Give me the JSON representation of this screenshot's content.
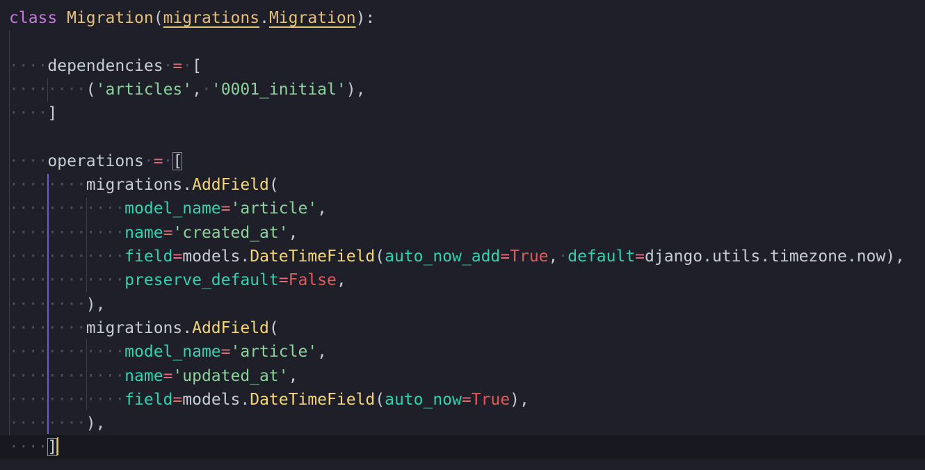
{
  "editor": {
    "language": "python",
    "colors": {
      "background": "#1e1f29",
      "keyword": "#c678dd",
      "class_name": "#e5c07b",
      "function": "#f7d774",
      "string": "#8bd39a",
      "parameter": "#31d2b0",
      "constant": "#e05b5b",
      "operator": "#e06c75",
      "text": "#c9ccd4",
      "indent_guide_active": "#6b5bd6",
      "caret": "#f0c33c"
    },
    "lines": [
      {
        "t": [
          {
            "c": "kw",
            "v": "class"
          },
          {
            "c": "plain",
            "v": " "
          },
          {
            "c": "cls",
            "v": "Migration"
          },
          {
            "c": "plain",
            "v": "("
          },
          {
            "c": "cls ul",
            "v": "migrations"
          },
          {
            "c": "plain",
            "v": "."
          },
          {
            "c": "cls ul",
            "v": "Migration"
          },
          {
            "c": "plain",
            "v": "):"
          }
        ]
      },
      {
        "t": []
      },
      {
        "t": [
          {
            "c": "ws",
            "v": "····"
          },
          {
            "c": "plain",
            "v": "dependencies"
          },
          {
            "c": "ws",
            "v": "·"
          },
          {
            "c": "op",
            "v": "="
          },
          {
            "c": "ws",
            "v": "·"
          },
          {
            "c": "plain",
            "v": "["
          }
        ]
      },
      {
        "t": [
          {
            "c": "ws",
            "v": "········"
          },
          {
            "c": "plain",
            "v": "("
          },
          {
            "c": "str",
            "v": "'articles'"
          },
          {
            "c": "plain",
            "v": ","
          },
          {
            "c": "ws",
            "v": "·"
          },
          {
            "c": "str",
            "v": "'0001_initial'"
          },
          {
            "c": "plain",
            "v": "),"
          }
        ]
      },
      {
        "t": [
          {
            "c": "ws",
            "v": "····"
          },
          {
            "c": "plain",
            "v": "]"
          }
        ]
      },
      {
        "t": []
      },
      {
        "t": [
          {
            "c": "ws",
            "v": "····"
          },
          {
            "c": "plain",
            "v": "operations"
          },
          {
            "c": "ws",
            "v": "·"
          },
          {
            "c": "op",
            "v": "="
          },
          {
            "c": "ws",
            "v": "·"
          },
          {
            "c": "plain bracket-hl",
            "v": "["
          }
        ]
      },
      {
        "t": [
          {
            "c": "ws",
            "v": "········"
          },
          {
            "c": "plain",
            "v": "migrations."
          },
          {
            "c": "fn",
            "v": "AddField"
          },
          {
            "c": "plain",
            "v": "("
          }
        ]
      },
      {
        "t": [
          {
            "c": "ws",
            "v": "············"
          },
          {
            "c": "param",
            "v": "model_name"
          },
          {
            "c": "op",
            "v": "="
          },
          {
            "c": "str",
            "v": "'article'"
          },
          {
            "c": "plain",
            "v": ","
          }
        ]
      },
      {
        "t": [
          {
            "c": "ws",
            "v": "············"
          },
          {
            "c": "param",
            "v": "name"
          },
          {
            "c": "op",
            "v": "="
          },
          {
            "c": "str",
            "v": "'created_at'"
          },
          {
            "c": "plain",
            "v": ","
          }
        ]
      },
      {
        "t": [
          {
            "c": "ws",
            "v": "············"
          },
          {
            "c": "param",
            "v": "field"
          },
          {
            "c": "op",
            "v": "="
          },
          {
            "c": "plain",
            "v": "models."
          },
          {
            "c": "fn",
            "v": "DateTimeField"
          },
          {
            "c": "plain",
            "v": "("
          },
          {
            "c": "param",
            "v": "auto_now_add"
          },
          {
            "c": "op",
            "v": "="
          },
          {
            "c": "const",
            "v": "True"
          },
          {
            "c": "plain",
            "v": ","
          },
          {
            "c": "ws",
            "v": "·"
          },
          {
            "c": "param",
            "v": "default"
          },
          {
            "c": "op",
            "v": "="
          },
          {
            "c": "plain",
            "v": "django.utils.timezone.now),"
          }
        ]
      },
      {
        "t": [
          {
            "c": "ws",
            "v": "············"
          },
          {
            "c": "param",
            "v": "preserve_default"
          },
          {
            "c": "op",
            "v": "="
          },
          {
            "c": "const",
            "v": "False"
          },
          {
            "c": "plain",
            "v": ","
          }
        ]
      },
      {
        "t": [
          {
            "c": "ws",
            "v": "········"
          },
          {
            "c": "plain",
            "v": "),"
          }
        ]
      },
      {
        "t": [
          {
            "c": "ws",
            "v": "········"
          },
          {
            "c": "plain",
            "v": "migrations."
          },
          {
            "c": "fn",
            "v": "AddField"
          },
          {
            "c": "plain",
            "v": "("
          }
        ]
      },
      {
        "t": [
          {
            "c": "ws",
            "v": "············"
          },
          {
            "c": "param",
            "v": "model_name"
          },
          {
            "c": "op",
            "v": "="
          },
          {
            "c": "str",
            "v": "'article'"
          },
          {
            "c": "plain",
            "v": ","
          }
        ]
      },
      {
        "t": [
          {
            "c": "ws",
            "v": "············"
          },
          {
            "c": "param",
            "v": "name"
          },
          {
            "c": "op",
            "v": "="
          },
          {
            "c": "str",
            "v": "'updated_at'"
          },
          {
            "c": "plain",
            "v": ","
          }
        ]
      },
      {
        "t": [
          {
            "c": "ws",
            "v": "············"
          },
          {
            "c": "param",
            "v": "field"
          },
          {
            "c": "op",
            "v": "="
          },
          {
            "c": "plain",
            "v": "models."
          },
          {
            "c": "fn",
            "v": "DateTimeField"
          },
          {
            "c": "plain",
            "v": "("
          },
          {
            "c": "param",
            "v": "auto_now"
          },
          {
            "c": "op",
            "v": "="
          },
          {
            "c": "const",
            "v": "True"
          },
          {
            "c": "plain",
            "v": "),"
          }
        ]
      },
      {
        "t": [
          {
            "c": "ws",
            "v": "········"
          },
          {
            "c": "plain",
            "v": "),"
          }
        ]
      },
      {
        "t": [
          {
            "c": "ws",
            "v": "····"
          },
          {
            "c": "plain bracket-hl",
            "v": "]"
          }
        ]
      }
    ],
    "current_line": 18
  }
}
